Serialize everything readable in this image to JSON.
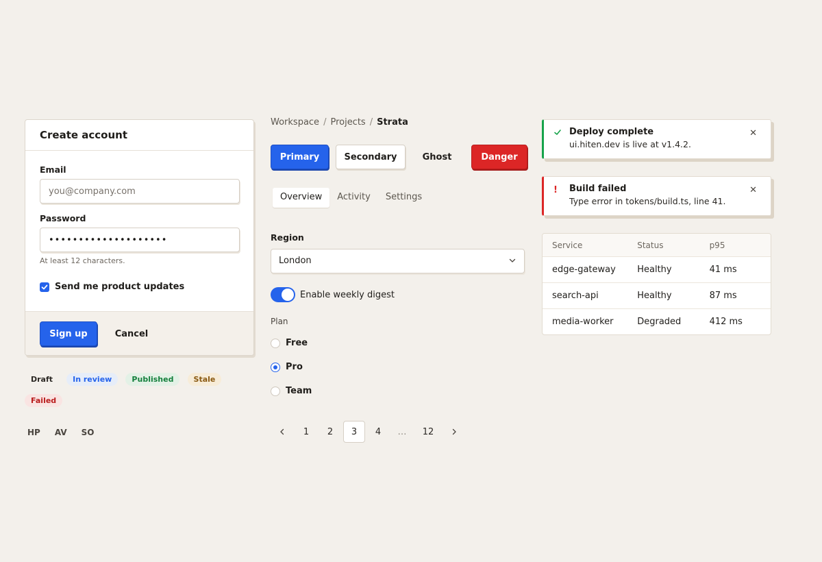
{
  "signup": {
    "title": "Create account",
    "email_label": "Email",
    "email_placeholder": "you@company.com",
    "password_label": "Password",
    "password_value": "••••••••••••••••••••",
    "password_hint": "At least 12 characters.",
    "updates_label": "Send me product updates",
    "updates_checked": true,
    "signup_label": "Sign up",
    "cancel_label": "Cancel"
  },
  "badges": [
    "Draft",
    "In review",
    "Published",
    "Stale",
    "Failed"
  ],
  "avatars": [
    "HP",
    "AV",
    "SO"
  ],
  "breadcrumb": {
    "items": [
      "Workspace",
      "Projects"
    ],
    "current": "Strata"
  },
  "buttons": {
    "primary": "Primary",
    "secondary": "Secondary",
    "ghost": "Ghost",
    "danger": "Danger"
  },
  "tabs": {
    "items": [
      "Overview",
      "Activity",
      "Settings"
    ],
    "active": "Overview"
  },
  "region": {
    "label": "Region",
    "value": "London"
  },
  "digest": {
    "label": "Enable weekly digest",
    "enabled": true
  },
  "plan": {
    "label": "Plan",
    "options": [
      "Free",
      "Pro",
      "Team"
    ],
    "selected": "Pro"
  },
  "pagination": {
    "pages": [
      "1",
      "2",
      "3",
      "4",
      "…",
      "12"
    ],
    "current": "3"
  },
  "toasts": [
    {
      "type": "success",
      "icon": "check-icon",
      "title": "Deploy complete",
      "message": "ui.hiten.dev is live at v1.4.2."
    },
    {
      "type": "error",
      "icon": "exclamation-icon",
      "title": "Build failed",
      "message": "Type error in tokens/build.ts, line 41."
    }
  ],
  "services": {
    "headers": [
      "Service",
      "Status",
      "p95"
    ],
    "rows": [
      [
        "edge-gateway",
        "Healthy",
        "41 ms"
      ],
      [
        "search-api",
        "Healthy",
        "87 ms"
      ],
      [
        "media-worker",
        "Degraded",
        "412 ms"
      ]
    ]
  },
  "colors": {
    "accent": "#2563eb",
    "danger": "#dc2626",
    "success": "#16a34a",
    "background": "#f3f0eb"
  }
}
